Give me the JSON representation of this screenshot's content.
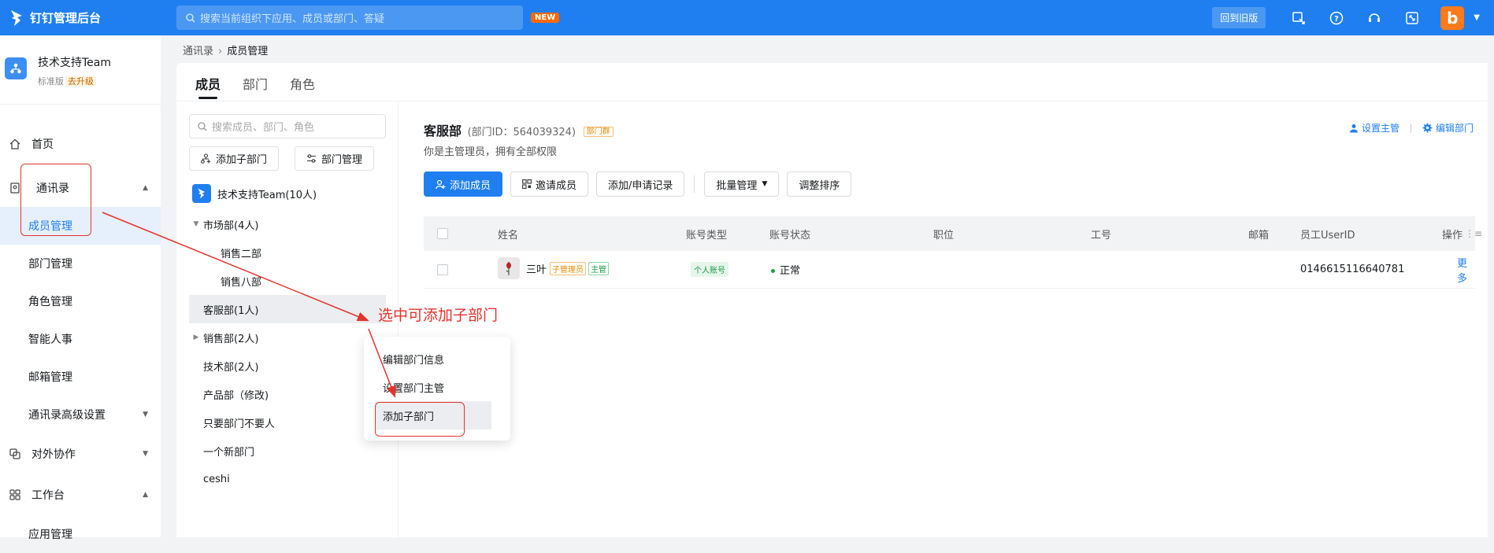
{
  "topbar": {
    "title": "钉钉管理后台",
    "search_placeholder": "搜索当前组织下应用、成员或部门、答疑",
    "new_badge": "NEW",
    "old_version_button": "回到旧版",
    "avatar_letter": "b",
    "accent": "#1f7ff0"
  },
  "org": {
    "name": "技术支持Team",
    "edition": "标准版",
    "upgrade": "去升级"
  },
  "sidebar": {
    "items": [
      {
        "label": "首页",
        "icon": "home-icon"
      },
      {
        "label": "通讯录",
        "icon": "contacts-icon"
      },
      {
        "label": "成员管理"
      },
      {
        "label": "部门管理"
      },
      {
        "label": "角色管理"
      },
      {
        "label": "智能人事"
      },
      {
        "label": "邮箱管理"
      },
      {
        "label": "通讯录高级设置"
      },
      {
        "label": "对外协作",
        "icon": "collab-icon"
      },
      {
        "label": "工作台",
        "icon": "grid-icon"
      },
      {
        "label": "应用管理"
      }
    ]
  },
  "breadcrumb": {
    "parent": "通讯录",
    "current": "成员管理"
  },
  "tabs": [
    "成员",
    "部门",
    "角色"
  ],
  "tree": {
    "search_placeholder": "搜索成员、部门、角色",
    "add_sub_dept": "添加子部门",
    "dept_manage": "部门管理",
    "root": "技术支持Team(10人)",
    "nodes": [
      "市场部(4人)",
      "销售二部",
      "销售八部",
      "客服部(1人)",
      "销售部(2人)",
      "技术部(2人)",
      "产品部（修改)",
      "只要部门不要人",
      "一个新部门",
      "ceshi"
    ]
  },
  "detail": {
    "dept_name": "客服部",
    "dept_id": "(部门ID：564039324)",
    "dept_tag": "部门群",
    "subtitle": "你是主管理员，拥有全部权限",
    "set_supervisor": "设置主管",
    "edit_dept": "编辑部门",
    "buttons": {
      "add_member": "添加成员",
      "invite": "邀请成员",
      "records": "添加/申请记录",
      "batch": "批量管理",
      "sort": "调整排序"
    },
    "columns": [
      "姓名",
      "账号类型",
      "账号状态",
      "职位",
      "工号",
      "邮箱",
      "员工UserID",
      "操作"
    ],
    "rows": [
      {
        "name": "三叶",
        "tag_admin": "子管理员",
        "tag_lead": "主管",
        "type": "个人账号",
        "status": "正常",
        "position": "",
        "job_no": "",
        "email": "",
        "userid": "0146615116640781",
        "action": "更多"
      }
    ]
  },
  "context_menu": [
    "编辑部门信息",
    "设置部门主管",
    "添加子部门"
  ],
  "annotation": {
    "text": "选中可添加子部门",
    "color": "#e5322d"
  }
}
